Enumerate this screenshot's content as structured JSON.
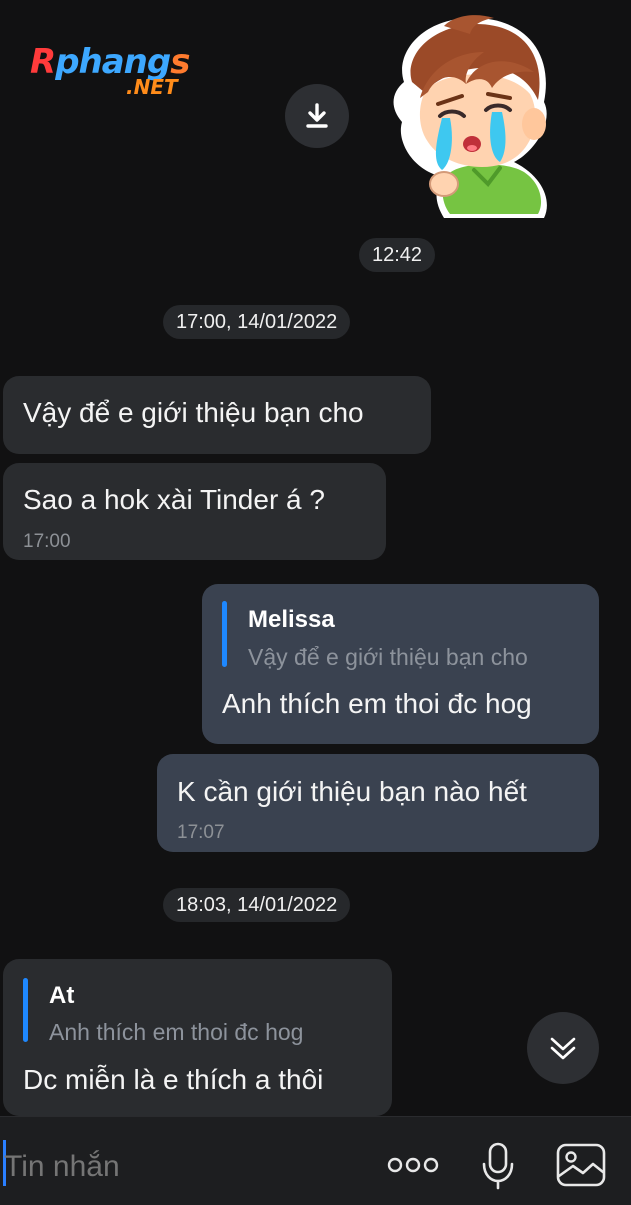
{
  "watermark": {
    "logo_parts": [
      "R",
      "phang",
      "s"
    ],
    "logo_sub": ".NET"
  },
  "sticker": {
    "download_icon": "download-icon",
    "description_icon": "crying-boy-sticker"
  },
  "timeline": [
    {
      "type": "time",
      "text": "12:42"
    },
    {
      "type": "date",
      "text": "17:00, 14/01/2022"
    },
    {
      "type": "date",
      "text": "18:03, 14/01/2022"
    }
  ],
  "messages": [
    {
      "side": "in",
      "text": "Vậy để e giới thiệu bạn cho"
    },
    {
      "side": "in",
      "text": "Sao a hok xài Tinder á ?",
      "time": "17:00"
    },
    {
      "side": "out",
      "quote_name": "Melissa",
      "quote_text": "Vậy để e giới thiệu bạn cho",
      "text": "Anh thích em thoi đc hog"
    },
    {
      "side": "out",
      "text": "K cần giới thiệu bạn nào hết",
      "time": "17:07"
    },
    {
      "side": "in",
      "quote_name": "At",
      "quote_text": "Anh thích em thoi đc hog",
      "text": "Dc miễn là e thích a thôi"
    }
  ],
  "composer": {
    "placeholder": "Tin nhắn",
    "more_icon": "more-dots-icon",
    "mic_icon": "microphone-icon",
    "image_icon": "image-icon"
  },
  "colors": {
    "background": "#111112",
    "bubble_in": "#2a2c2f",
    "bubble_out": "#3a4250",
    "quote_bar": "#1e88ff"
  }
}
